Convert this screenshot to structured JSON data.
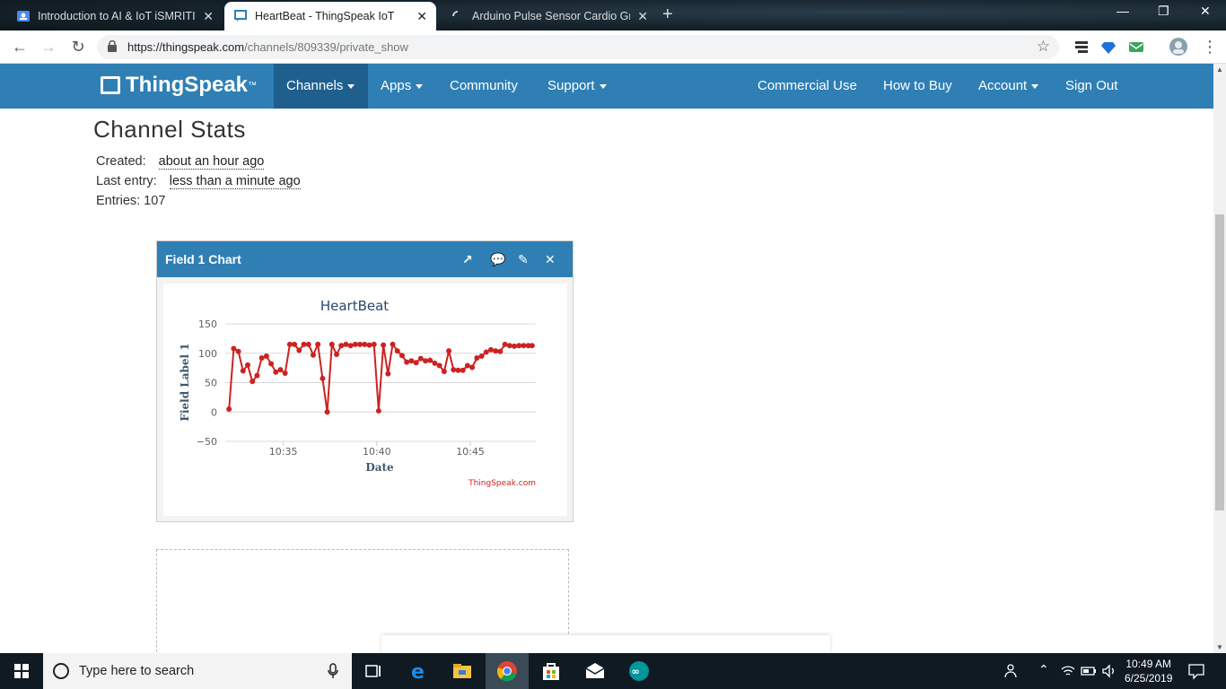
{
  "browser": {
    "tabs": [
      {
        "title": "Introduction to AI & IoT iSMRITI",
        "active": false
      },
      {
        "title": "HeartBeat - ThingSpeak IoT",
        "active": true
      },
      {
        "title": "Arduino Pulse Sensor Cardio Gra",
        "active": false
      }
    ],
    "url_host": "https://thingspeak.com",
    "url_path": "/channels/809339/private_show"
  },
  "nav": {
    "logo": "ThingSpeak",
    "logo_tm": "™",
    "left_items": [
      "Channels",
      "Apps",
      "Community",
      "Support"
    ],
    "right_items": [
      "Commercial Use",
      "How to Buy",
      "Account",
      "Sign Out"
    ]
  },
  "stats": {
    "heading": "Channel Stats",
    "created_label": "Created:",
    "created_value": "about an hour ago",
    "last_entry_label": "Last entry:",
    "last_entry_value": "less than a minute ago",
    "entries": "Entries: 107"
  },
  "widget": {
    "title": "Field 1 Chart"
  },
  "chart_data": {
    "type": "line",
    "title": "HeartBeat",
    "xlabel": "Date",
    "ylabel": "Field Label 1",
    "credit": "ThingSpeak.com",
    "ylim": [
      -50,
      150
    ],
    "yticks": [
      "150",
      "100",
      "50",
      "0",
      "−50"
    ],
    "xticks": [
      "10:35",
      "10:40",
      "10:45"
    ],
    "xlim_minutes": [
      10.2,
      27.3
    ],
    "xtick_minutes": [
      35,
      40,
      45
    ],
    "color": "#cc2222",
    "series": [
      {
        "x": [
          32.1,
          32.35,
          32.6,
          32.85,
          33.1,
          33.35,
          33.6,
          33.85,
          34.1,
          34.35,
          34.6,
          34.85,
          35.1,
          35.35,
          35.6,
          35.85,
          36.1,
          36.35,
          36.6,
          36.85,
          37.1,
          37.35,
          37.6,
          37.85,
          38.1,
          38.35,
          38.6,
          38.85,
          39.1,
          39.35,
          39.6,
          39.85,
          40.1,
          40.35,
          40.6,
          40.85,
          41.1,
          41.35,
          41.6,
          41.85,
          42.1,
          42.35,
          42.6,
          42.85,
          43.1,
          43.35,
          43.6,
          43.85,
          44.1,
          44.35,
          44.6,
          44.85,
          45.1,
          45.35,
          45.6,
          45.85,
          46.1,
          46.35,
          46.6,
          46.85,
          47.1,
          47.35,
          47.6,
          47.85,
          48.1,
          48.3
        ],
        "y": [
          5,
          108,
          103,
          70,
          80,
          52,
          62,
          92,
          95,
          82,
          68,
          72,
          66,
          115,
          115,
          105,
          115,
          115,
          97,
          115,
          57,
          0,
          115,
          98,
          113,
          115,
          113,
          115,
          115,
          115,
          114,
          115,
          2,
          114,
          65,
          115,
          104,
          96,
          85,
          87,
          84,
          91,
          87,
          88,
          83,
          79,
          69,
          104,
          72,
          71,
          71,
          79,
          76,
          92,
          95,
          102,
          106,
          104,
          103,
          115,
          113,
          112,
          113,
          113,
          113,
          113
        ]
      }
    ]
  },
  "taskbar": {
    "search_placeholder": "Type here to search",
    "time": "10:49 AM",
    "date": "6/25/2019"
  }
}
